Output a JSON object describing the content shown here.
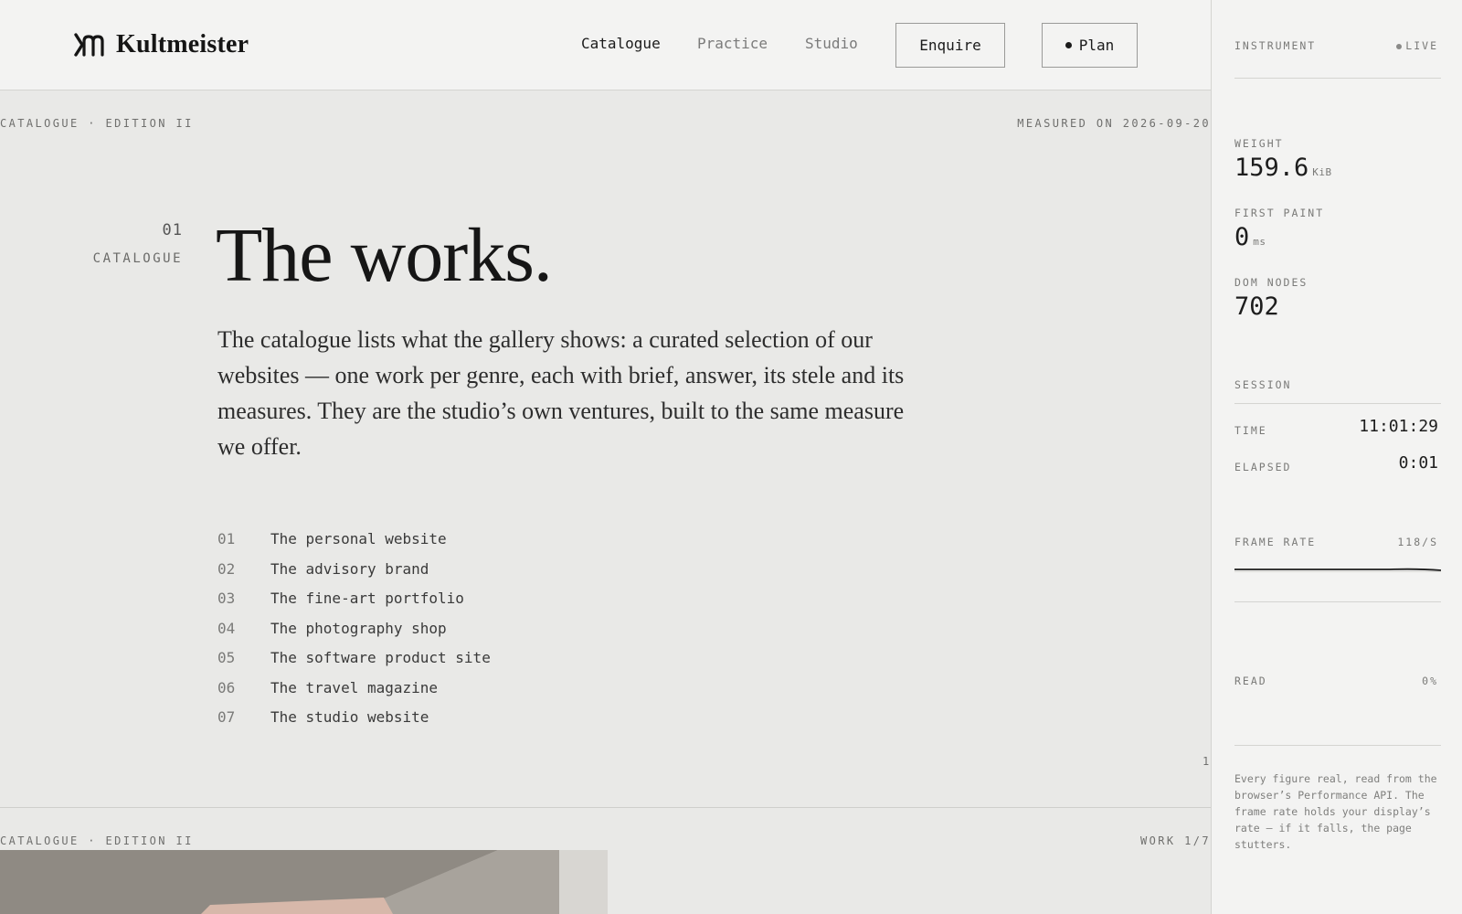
{
  "header": {
    "brand": "Kultmeister",
    "nav": [
      {
        "label": "Catalogue",
        "active": true
      },
      {
        "label": "Practice",
        "active": false
      },
      {
        "label": "Studio",
        "active": false
      }
    ],
    "enquire_label": "Enquire",
    "plan_label": "Plan"
  },
  "main": {
    "kicker_left": "CATALOGUE · EDITION II",
    "kicker_right": "MEASURED ON 2026-09-20",
    "section_number": "01",
    "section_label": "CATALOGUE",
    "title": "The works.",
    "intro": "The catalogue lists what the gallery shows: a curated selection of our websites — one work per genre, each with brief, answer, its stele and its measures. They are the studio’s own ventures, built to the same measure we offer.",
    "works": [
      {
        "num": "01",
        "title": "The personal website"
      },
      {
        "num": "02",
        "title": "The advisory brand"
      },
      {
        "num": "03",
        "title": "The fine-art portfolio"
      },
      {
        "num": "04",
        "title": "The photography shop"
      },
      {
        "num": "05",
        "title": "The software product site"
      },
      {
        "num": "06",
        "title": "The travel magazine"
      },
      {
        "num": "07",
        "title": "The studio website"
      }
    ],
    "page_number": "1",
    "next_kicker_left": "CATALOGUE · EDITION II",
    "next_kicker_right": "WORK 1/7"
  },
  "panel": {
    "title": "INSTRUMENT",
    "status": "LIVE",
    "weight_label": "WEIGHT",
    "weight_value": "159.6",
    "weight_unit": "KiB",
    "first_paint_label": "FIRST PAINT",
    "first_paint_value": "0",
    "first_paint_unit": "ms",
    "dom_nodes_label": "DOM NODES",
    "dom_nodes_value": "702",
    "session_label": "SESSION",
    "time_label": "TIME",
    "time_value": "11:01:29",
    "elapsed_label": "ELAPSED",
    "elapsed_value": "0:01",
    "frame_rate_label": "FRAME RATE",
    "frame_rate_value": "118/S",
    "read_label": "READ",
    "read_value": "0%",
    "note": "Every figure real, read from the browser’s Performance API. The frame rate holds your display’s rate — if it falls, the page stutters."
  },
  "colors": {
    "background": "#e9e9e7",
    "header_bg": "#f3f3f2",
    "text": "#1b1b1b",
    "muted": "#7a7a78"
  }
}
